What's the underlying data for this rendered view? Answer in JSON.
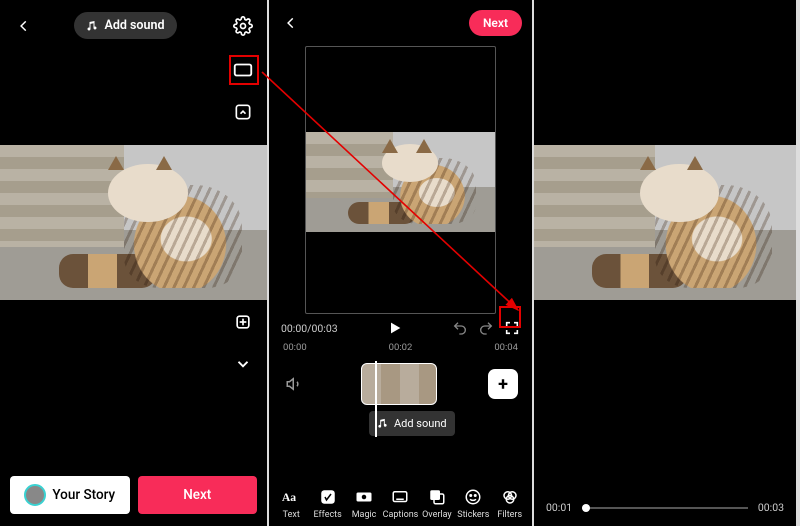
{
  "pane1": {
    "add_sound_label": "Add sound",
    "your_story_label": "Your Story",
    "next_label": "Next",
    "tools": [
      "rotate",
      "flip",
      "text",
      "sticker",
      "sparkle",
      "filter",
      "crop",
      "more"
    ]
  },
  "pane2": {
    "next_label": "Next",
    "time_current": "00:00",
    "time_total": "00:03",
    "ticks": [
      "00:00",
      "00:02",
      "00:04"
    ],
    "add_sound_label": "Add sound",
    "tools": [
      {
        "key": "text",
        "label": "Text"
      },
      {
        "key": "effects",
        "label": "Effects"
      },
      {
        "key": "magic",
        "label": "Magic"
      },
      {
        "key": "captions",
        "label": "Captions"
      },
      {
        "key": "overlay",
        "label": "Overlay"
      },
      {
        "key": "stickers",
        "label": "Stickers"
      },
      {
        "key": "filters",
        "label": "Filters"
      }
    ]
  },
  "pane3": {
    "time_current": "00:01",
    "time_total": "00:03"
  }
}
